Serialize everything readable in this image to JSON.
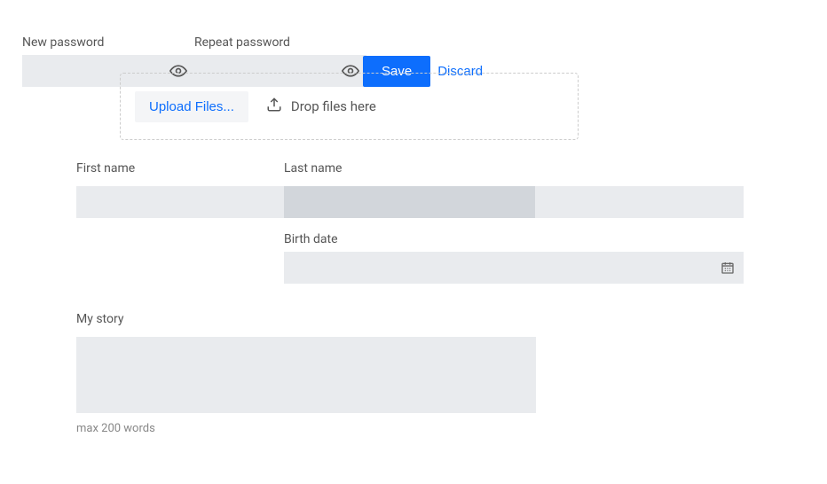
{
  "passwords": {
    "new_label": "New password",
    "repeat_label": "Repeat password",
    "new_value": "",
    "repeat_value": ""
  },
  "actions": {
    "save_label": "Save",
    "discard_label": "Discard"
  },
  "upload": {
    "button_label": "Upload Files...",
    "drop_hint": "Drop files here"
  },
  "name": {
    "first_label": "First name",
    "last_label": "Last name",
    "first_value": "",
    "last_value": ""
  },
  "birth": {
    "label": "Birth date",
    "value": ""
  },
  "story": {
    "label": "My story",
    "value": "",
    "hint": "max 200 words"
  }
}
